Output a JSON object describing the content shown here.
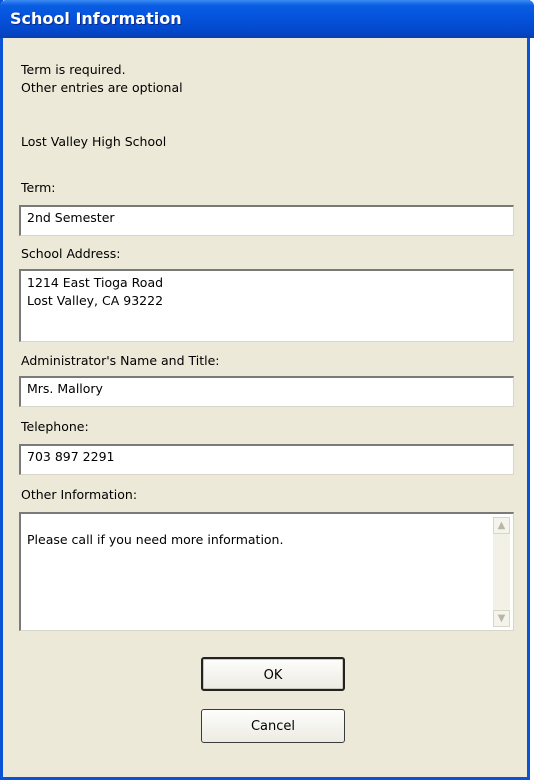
{
  "window": {
    "title": "School Information"
  },
  "instructions": {
    "line1": "Term is required.\nOther entries are optional"
  },
  "school_name": "Lost Valley High School",
  "fields": {
    "term": {
      "label": "Term:",
      "value": "2nd Semester"
    },
    "address": {
      "label": "School Address:",
      "value": "1214 East Tioga Road\nLost Valley, CA 93222"
    },
    "administrator": {
      "label": "Administrator's Name and Title:",
      "value": "Mrs. Mallory"
    },
    "telephone": {
      "label": "Telephone:",
      "value": "703 897 2291"
    },
    "other": {
      "label": "Other Information:",
      "value": "Please call if you need more information."
    }
  },
  "buttons": {
    "ok": "OK",
    "cancel": "Cancel"
  },
  "icons": {
    "scroll_up": "scroll-up-arrow-icon",
    "scroll_down": "scroll-down-arrow-icon"
  },
  "colors": {
    "titlebar": "#0553dd",
    "dialog_bg": "#ece9d8"
  }
}
